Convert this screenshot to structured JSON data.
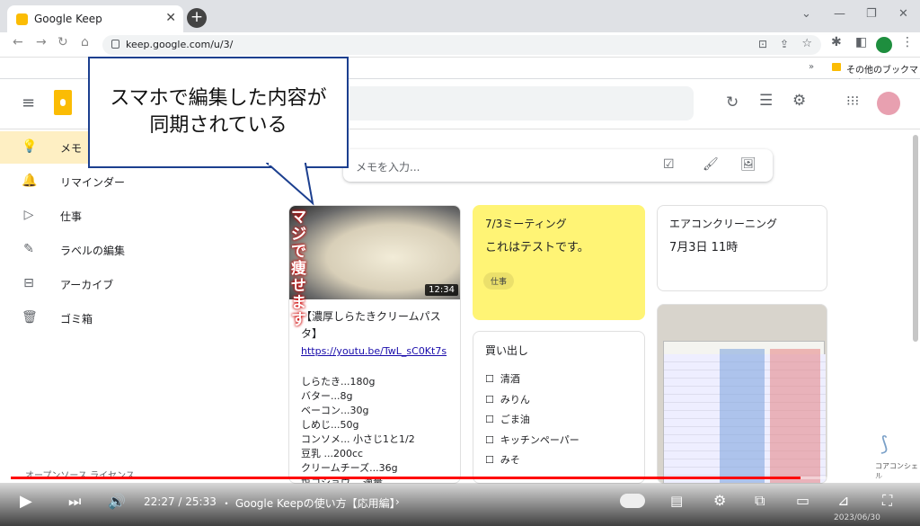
{
  "browser": {
    "tab_title": "Google Keep",
    "url": "keep.google.com/u/3/",
    "bookmark_other": "その他のブックマーク"
  },
  "sidebar": {
    "items": [
      {
        "label": "メモ",
        "icon": "lightbulb-icon"
      },
      {
        "label": "リマインダー",
        "icon": "bell-icon"
      },
      {
        "label": "仕事",
        "icon": "label-icon"
      },
      {
        "label": "ラベルの編集",
        "icon": "pencil-icon"
      },
      {
        "label": "アーカイブ",
        "icon": "archive-icon"
      },
      {
        "label": "ゴミ箱",
        "icon": "trash-icon"
      }
    ],
    "footer": "オープンソース ライセンス"
  },
  "callout": {
    "line1": "スマホで編集した内容が",
    "line2": "同期されている"
  },
  "take_note": {
    "placeholder": "メモを入力..."
  },
  "notes": {
    "recipe": {
      "thumb_duration": "12:34",
      "thumb_text": "マジで痩せます",
      "title": "【濃厚しらたきクリームパスタ】",
      "link": "https://youtu.be/TwL_sC0Kt7s",
      "lines": [
        "しらたき...180g",
        "バター...8g",
        "ベーコン...30g",
        "しめじ...50g",
        "コンソメ... 小さじ1と1/2",
        "豆乳 ...200cc",
        "クリームチーズ...36g",
        "塩コショウ... 適量"
      ]
    },
    "meeting": {
      "title": "7/3ミーティング",
      "body": "これはテストです。",
      "label": "仕事",
      "color": "#fff475"
    },
    "aircon": {
      "title": "エアコンクリーニング",
      "body": "7月3日 11時"
    },
    "shopping": {
      "title": "買い出し",
      "items": [
        "清酒",
        "みりん",
        "ごま油",
        "キッチンペーパー",
        "みそ"
      ]
    }
  },
  "video": {
    "time": "22:27 / 25:33",
    "chapter": "・ Google Keepの使い方【応用編】",
    "progress": 0.879,
    "date": "2023/06/30",
    "channel": "コアコンシェル"
  }
}
